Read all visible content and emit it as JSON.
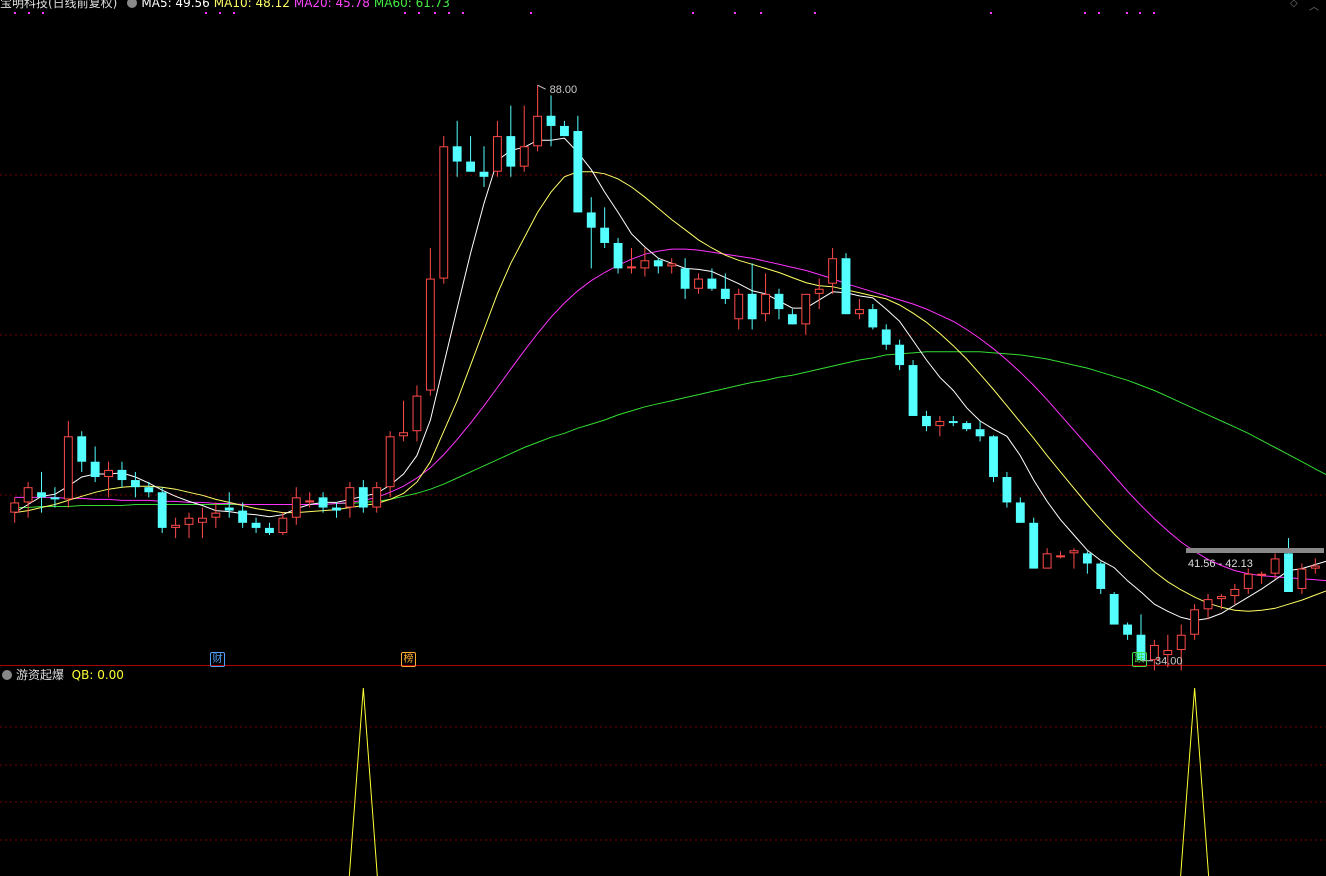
{
  "header": {
    "title": "宝明科技(日线前复权)",
    "ma5": "MA5: 49.56",
    "ma10": "MA10: 48.12",
    "ma20": "MA20: 45.78",
    "ma60": "MA60: 61.73"
  },
  "colors": {
    "up": "#ff4a4a",
    "down": "#54ffff",
    "ma5": "#ffffff",
    "ma10": "#ffff66",
    "ma20": "#ff33ff",
    "ma60": "#33dd33",
    "grid": "#7a0000",
    "indicator": "#ffff33"
  },
  "annotations": {
    "high_label": "88.00",
    "low_label": "34.00",
    "range_label": "41.56 - 42.13"
  },
  "event_tags": [
    {
      "text": "财",
      "color": "#4fa3ff"
    },
    {
      "text": "榜",
      "color": "#ffaa33"
    },
    {
      "text": "跌",
      "color": "#44dd44"
    }
  ],
  "indicator": {
    "title": "游资起爆",
    "value": "QB: 0.00"
  },
  "chart_data": {
    "type": "candlestick",
    "ylim": [
      32.5,
      95
    ],
    "candles": [
      [
        46,
        47.5,
        45,
        47
      ],
      [
        47,
        49,
        45.5,
        48.5
      ],
      [
        48,
        50,
        46,
        47.5
      ],
      [
        47.5,
        48.5,
        46.5,
        47.3
      ],
      [
        47.3,
        55,
        46.5,
        53.5
      ],
      [
        53.5,
        54,
        50,
        51
      ],
      [
        51,
        52.5,
        49,
        49.5
      ],
      [
        49.5,
        51,
        47.5,
        50.2
      ],
      [
        50.2,
        51,
        48.5,
        49.2
      ],
      [
        49.2,
        50,
        47.5,
        48.5
      ],
      [
        48.5,
        49,
        47.5,
        48
      ],
      [
        48,
        48.5,
        44,
        44.5
      ],
      [
        44.5,
        45.5,
        43.5,
        44.8
      ],
      [
        44.8,
        46,
        43.5,
        45.5
      ],
      [
        45,
        46.5,
        43.5,
        45.5
      ],
      [
        45.5,
        47,
        44.5,
        46
      ],
      [
        46.5,
        48,
        45.5,
        46.2
      ],
      [
        46.2,
        47,
        44.5,
        45
      ],
      [
        45,
        45.5,
        44,
        44.5
      ],
      [
        44.5,
        45,
        43.8,
        44
      ],
      [
        44,
        46,
        43.8,
        45.5
      ],
      [
        45.5,
        48.5,
        44.8,
        47.5
      ],
      [
        47,
        48,
        46.5,
        47.2
      ],
      [
        47.5,
        48,
        46,
        46.5
      ],
      [
        46.5,
        47,
        45.5,
        46.2
      ],
      [
        46.5,
        49,
        45.5,
        48.5
      ],
      [
        48.5,
        49.2,
        46,
        46.5
      ],
      [
        46.5,
        49,
        46,
        48.5
      ],
      [
        48.5,
        54,
        47.5,
        53.5
      ],
      [
        53.5,
        57,
        53,
        53.9
      ],
      [
        54,
        58.5,
        53,
        57.5
      ],
      [
        58,
        72,
        57.5,
        69
      ],
      [
        69,
        83,
        68.5,
        82
      ],
      [
        82,
        84.5,
        79,
        80.5
      ],
      [
        80.5,
        83,
        79.5,
        79.5
      ],
      [
        79.5,
        82,
        78,
        79
      ],
      [
        79.5,
        84.5,
        79,
        83
      ],
      [
        83,
        86,
        79,
        80
      ],
      [
        80,
        86,
        79.5,
        82
      ],
      [
        82,
        88,
        81.5,
        85
      ],
      [
        85,
        87,
        82,
        84
      ],
      [
        84,
        84.5,
        83,
        83
      ],
      [
        83.5,
        85,
        77,
        75.5
      ],
      [
        75.5,
        77,
        70,
        74
      ],
      [
        74,
        76,
        72,
        72.5
      ],
      [
        72.5,
        73,
        69.5,
        70
      ],
      [
        70,
        72,
        69.5,
        70.2
      ],
      [
        70,
        72,
        69.2,
        70.8
      ],
      [
        70.8,
        71,
        69.5,
        70.2
      ],
      [
        70.2,
        71,
        69.5,
        70.5
      ],
      [
        70,
        71,
        67,
        68
      ],
      [
        68,
        69.5,
        67.5,
        69
      ],
      [
        69,
        70,
        67.8,
        68
      ],
      [
        68,
        69.5,
        66.5,
        67
      ],
      [
        65,
        68,
        64,
        67.5
      ],
      [
        67.5,
        70.5,
        64,
        65
      ],
      [
        65.5,
        69.5,
        64.8,
        67.5
      ],
      [
        67.5,
        68,
        65,
        66
      ],
      [
        65.5,
        66,
        64.5,
        64.5
      ],
      [
        64.5,
        67.5,
        63.5,
        67.5
      ],
      [
        67.5,
        69,
        66,
        68
      ],
      [
        68.5,
        72,
        67.5,
        71
      ],
      [
        71,
        71.5,
        65.5,
        65.5
      ],
      [
        65.5,
        67,
        65,
        66
      ],
      [
        66,
        66.5,
        64,
        64.2
      ],
      [
        64,
        64.5,
        62,
        62.5
      ],
      [
        62.5,
        63,
        60,
        60.5
      ],
      [
        60.5,
        61,
        55.5,
        55.5
      ],
      [
        55.5,
        56,
        54,
        54.5
      ],
      [
        54.5,
        55.5,
        53.5,
        55
      ],
      [
        55,
        55.5,
        54.5,
        54.8
      ],
      [
        54.8,
        55,
        54,
        54.2
      ],
      [
        54.2,
        55,
        53,
        53.5
      ],
      [
        53.5,
        53.6,
        49,
        49.5
      ],
      [
        49.5,
        50,
        46.5,
        47
      ],
      [
        47,
        47.5,
        45,
        45
      ],
      [
        45,
        45.5,
        40.5,
        40.5
      ],
      [
        40.5,
        42.5,
        40.5,
        42
      ],
      [
        41.8,
        42.2,
        41.5,
        41.8
      ],
      [
        42,
        42.5,
        40.5,
        42.3
      ],
      [
        42,
        42.2,
        40,
        41
      ],
      [
        41,
        41.2,
        38,
        38.5
      ],
      [
        38,
        38.2,
        35,
        35
      ],
      [
        35,
        35.2,
        33.5,
        34
      ],
      [
        34,
        36,
        33.5,
        31.5
      ],
      [
        31.5,
        33.5,
        30.5,
        33
      ],
      [
        32,
        34,
        30.8,
        32.5
      ],
      [
        32.5,
        35,
        30.5,
        34
      ],
      [
        34,
        37,
        33.5,
        36.5
      ],
      [
        36.5,
        38,
        35.5,
        37.5
      ],
      [
        37.5,
        38,
        36.5,
        37.8
      ],
      [
        37.8,
        39,
        37,
        38.5
      ],
      [
        38.5,
        40.5,
        38,
        40
      ],
      [
        40,
        40.2,
        39,
        40
      ],
      [
        40,
        42,
        39.5,
        41.5
      ],
      [
        42,
        43.5,
        38.5,
        38.2
      ],
      [
        38.5,
        41,
        38,
        40.5
      ],
      [
        40.5,
        41.5,
        40,
        40.8
      ]
    ],
    "ma5": [
      46,
      46.8,
      47.6,
      47.8,
      48.6,
      49.5,
      49.8,
      49.8,
      49.9,
      49.5,
      48.9,
      48.2,
      47.6,
      47.1,
      46.7,
      46.2,
      46.1,
      45.9,
      45.8,
      45.6,
      45.8,
      46.4,
      46.8,
      47,
      47,
      47.3,
      47.6,
      47.9,
      48.7,
      49.8,
      51.6,
      55.1,
      60.6,
      66.1,
      71.5,
      76.4,
      80.6,
      81.6,
      81.9,
      82.6,
      82.6,
      82.8,
      81.4,
      79.7,
      77.5,
      75.5,
      73.4,
      72.1,
      71,
      70.5,
      70,
      69.9,
      69.7,
      69.1,
      68.5,
      67.8,
      67.5,
      66.8,
      66.1,
      66.1,
      66.9,
      67.7,
      67.6,
      67.3,
      67.1,
      66,
      64.8,
      62.9,
      61,
      59.3,
      58,
      56.3,
      55,
      54.2,
      53.5,
      51.6,
      49.2,
      47.1,
      45.3,
      43.8,
      42.3,
      41.3,
      40.6,
      39.3,
      38.2,
      37,
      36.3,
      35.7,
      35.4,
      35.6,
      36.1,
      36.9,
      37.7,
      38.5,
      39.4,
      40.3,
      40.5,
      40.9,
      41.3
    ],
    "ma10": [
      46,
      46.2,
      46.5,
      46.8,
      47.2,
      47.6,
      48,
      48.3,
      48.5,
      48.6,
      48.6,
      48.5,
      48.3,
      48,
      47.7,
      47.3,
      47,
      46.7,
      46.4,
      46.2,
      46,
      46,
      46.1,
      46.2,
      46.3,
      46.5,
      46.7,
      46.9,
      47.3,
      47.9,
      49,
      51,
      54,
      57,
      60.5,
      64,
      67.5,
      70.5,
      73,
      75.5,
      77.5,
      79,
      79.5,
      79.5,
      79.3,
      78.8,
      78,
      77,
      75.9,
      74.8,
      73.8,
      72.8,
      72,
      71.3,
      70.8,
      70.4,
      70,
      69.6,
      69.1,
      68.6,
      68.3,
      68.2,
      67.9,
      67.6,
      67.3,
      67,
      66.4,
      65.6,
      64.7,
      63.6,
      62.4,
      61.1,
      59.6,
      58.1,
      56.5,
      54.9,
      53.3,
      51.6,
      50,
      48.4,
      46.8,
      45.3,
      43.9,
      42.6,
      41.4,
      40.2,
      39.2,
      38.4,
      37.7,
      37.1,
      36.7,
      36.4,
      36.3,
      36.4,
      36.6,
      37,
      37.4,
      37.9,
      38.4
    ],
    "ma20": [
      47.5,
      47.5,
      47.5,
      47.5,
      47.4,
      47.4,
      47.3,
      47.3,
      47.2,
      47.2,
      47.2,
      47.1,
      47.1,
      47,
      47,
      46.9,
      46.9,
      46.8,
      46.8,
      46.8,
      46.8,
      46.8,
      46.8,
      46.8,
      46.9,
      47,
      47.2,
      47.5,
      48,
      48.6,
      49.4,
      50.4,
      51.7,
      53.2,
      54.8,
      56.5,
      58.3,
      60.1,
      61.9,
      63.6,
      65.2,
      66.6,
      67.8,
      68.8,
      69.6,
      70.3,
      70.9,
      71.4,
      71.7,
      71.9,
      71.9,
      71.8,
      71.6,
      71.4,
      71.2,
      71,
      70.7,
      70.4,
      70.1,
      69.8,
      69.4,
      69,
      68.5,
      68.1,
      67.7,
      67.3,
      66.9,
      66.5,
      66,
      65.4,
      64.8,
      64,
      63.1,
      62.1,
      61,
      59.8,
      58.5,
      57.1,
      55.6,
      54.1,
      52.6,
      51.1,
      49.6,
      48.1,
      46.7,
      45.4,
      44.2,
      43.1,
      42.2,
      41.4,
      40.8,
      40.3,
      40,
      39.8,
      39.7,
      39.6,
      39.5,
      39.4,
      39.3
    ],
    "ma60": [
      46.5,
      46.5,
      46.6,
      46.6,
      46.6,
      46.7,
      46.7,
      46.7,
      46.7,
      46.8,
      46.8,
      46.8,
      46.8,
      46.8,
      46.8,
      46.8,
      46.8,
      46.8,
      46.8,
      46.8,
      46.8,
      46.8,
      46.8,
      46.8,
      46.9,
      46.9,
      47,
      47.1,
      47.3,
      47.6,
      47.9,
      48.3,
      48.8,
      49.4,
      50,
      50.6,
      51.2,
      51.8,
      52.4,
      52.9,
      53.4,
      53.8,
      54.3,
      54.7,
      55.1,
      55.6,
      56,
      56.4,
      56.7,
      57,
      57.3,
      57.6,
      57.9,
      58.2,
      58.5,
      58.8,
      59,
      59.3,
      59.5,
      59.8,
      60.1,
      60.4,
      60.7,
      61,
      61.2,
      61.5,
      61.6,
      61.7,
      61.8,
      61.8,
      61.8,
      61.8,
      61.8,
      61.7,
      61.6,
      61.5,
      61.3,
      61.1,
      60.8,
      60.5,
      60.2,
      59.8,
      59.4,
      59,
      58.5,
      58,
      57.4,
      56.8,
      56.2,
      55.6,
      55,
      54.4,
      53.8,
      53.1,
      52.4,
      51.7,
      51,
      50.3,
      49.6
    ],
    "indicator_series": {
      "name": "QB",
      "spikes_at": [
        26,
        88
      ],
      "peak": 1
    }
  }
}
